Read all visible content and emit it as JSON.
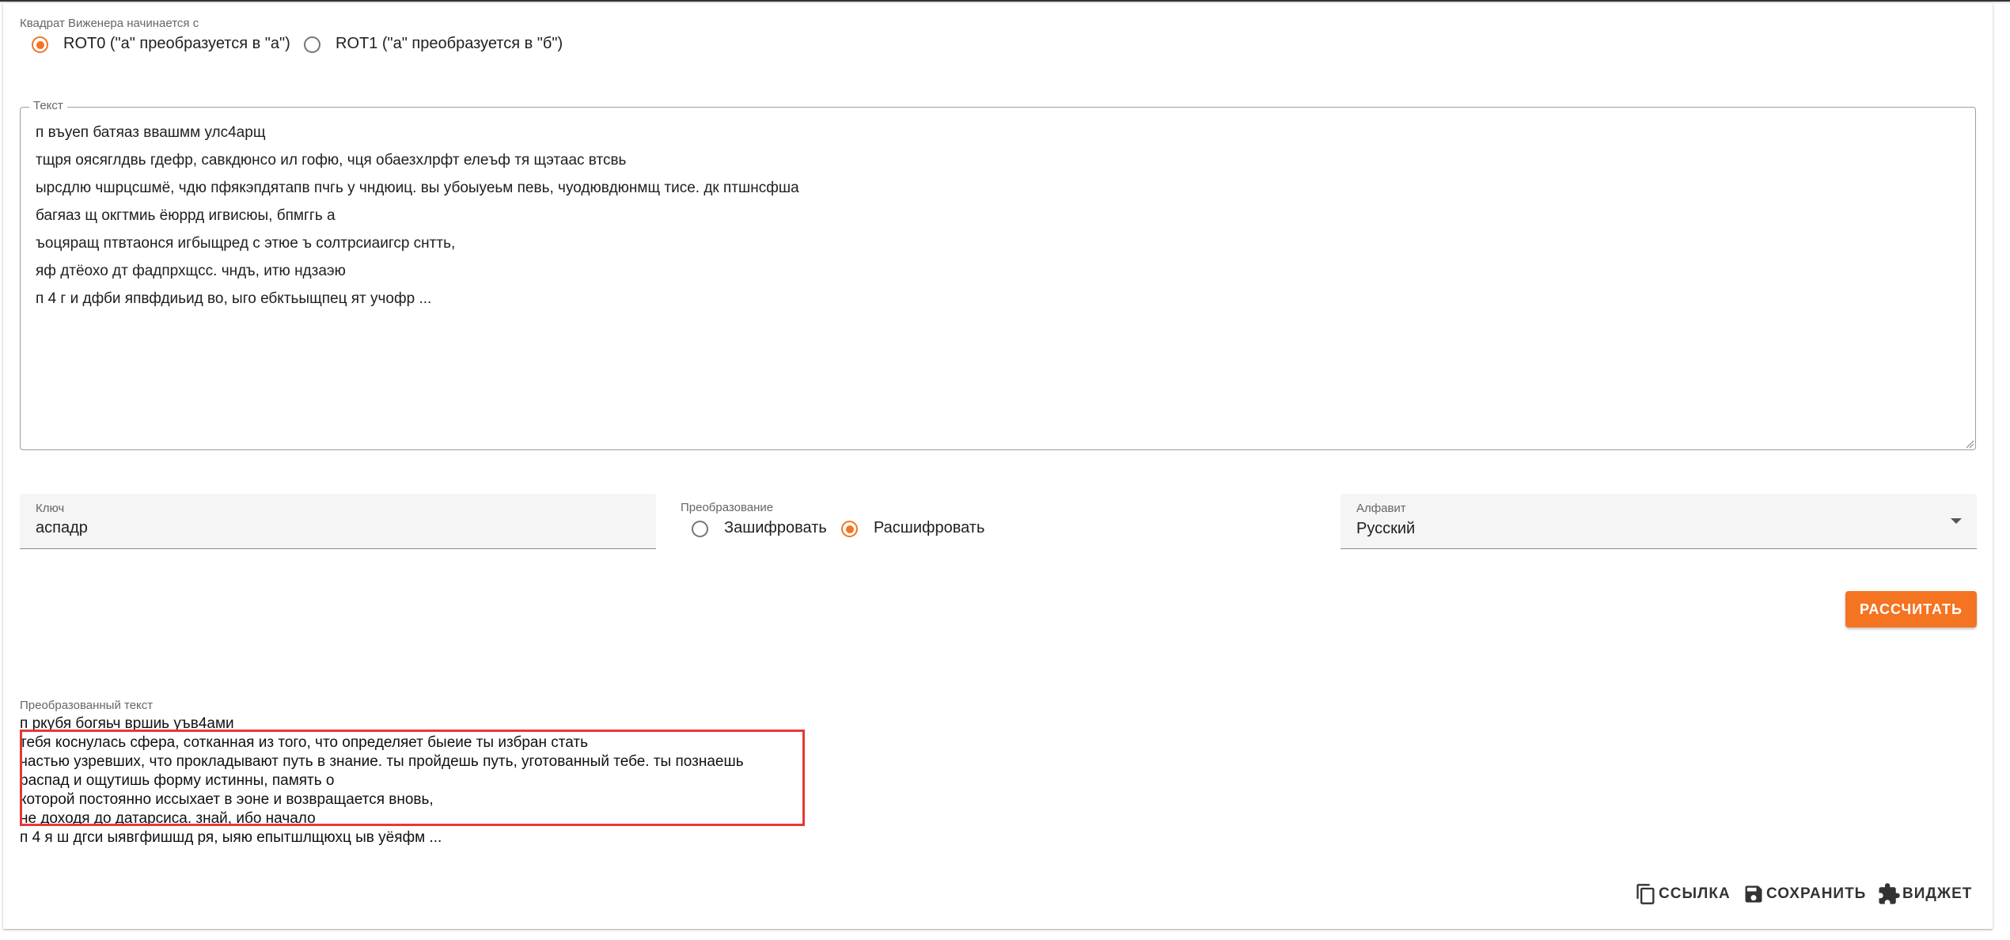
{
  "vigenere_start": {
    "label": "Квадрат Виженера начинается с",
    "options": [
      {
        "label": "ROT0 (\"а\" преобразуется в \"а\")",
        "checked": true
      },
      {
        "label": "ROT1 (\"а\" преобразуется в \"б\")",
        "checked": false
      }
    ]
  },
  "text_field": {
    "label": "Текст",
    "lines": [
      "п въуеп батяаз ввашмм улс4арщ",
      "тщря оясяглдвь гдефр, савкдюнсо ил гофю, чця обаезхлрфт елеъф тя щэтаас втсвь",
      "ырсдлю чшрцсшмё, чдю пфякэпдятапв пчгь у чндюиц. вы убоыуеьм певь, чуодювдюнмщ тисе. дк птшнсфша",
      "багяаз щ окгтмиь ёюррд игвисюы, бпмггь а",
      "ъоцяращ птвтаонся игбыщред с этюе ъ солтрсиаигср снтть,",
      "яф дтёохо дт фадпрхщсс. чндъ, итю ндзаэю",
      "п 4 г и дфби япвфдиьид во, ыго ебктьыщпец ят учофр ..."
    ]
  },
  "key_field": {
    "label": "Ключ",
    "value": "аспадр"
  },
  "transform": {
    "label": "Преобразование",
    "options": [
      {
        "label": "Зашифровать",
        "checked": false
      },
      {
        "label": "Расшифровать",
        "checked": true
      }
    ]
  },
  "alphabet": {
    "label": "Алфавит",
    "value": "Русский"
  },
  "calculate_label": "РАССЧИТАТЬ",
  "output": {
    "label": "Преобразованный текст",
    "lines": [
      "п ркубя богяьч вршиь уъв4ами",
      "тебя коснулась сфера, сотканная из того, что определяет быеие ты избран стать",
      "частью узревших, что прокладывают путь в знание. ты пройдешь путь, уготованный тебе. ты познаешь",
      "распад и ощутишь форму истинны, память о",
      "которой постоянно иссыхает в эоне и возвращается вновь,",
      "не доходя до датарсиса. знай, ибо начало",
      "п 4 я ш дгси ыявгфишшд ря, ыяю епытшлщюхц ыв уёяфм ..."
    ]
  },
  "actions": {
    "link": "ССЫЛКА",
    "save": "СОХРАНИТЬ",
    "widget": "ВИДЖЕТ"
  },
  "colors": {
    "accent": "#f47421",
    "highlight": "#e53935"
  }
}
